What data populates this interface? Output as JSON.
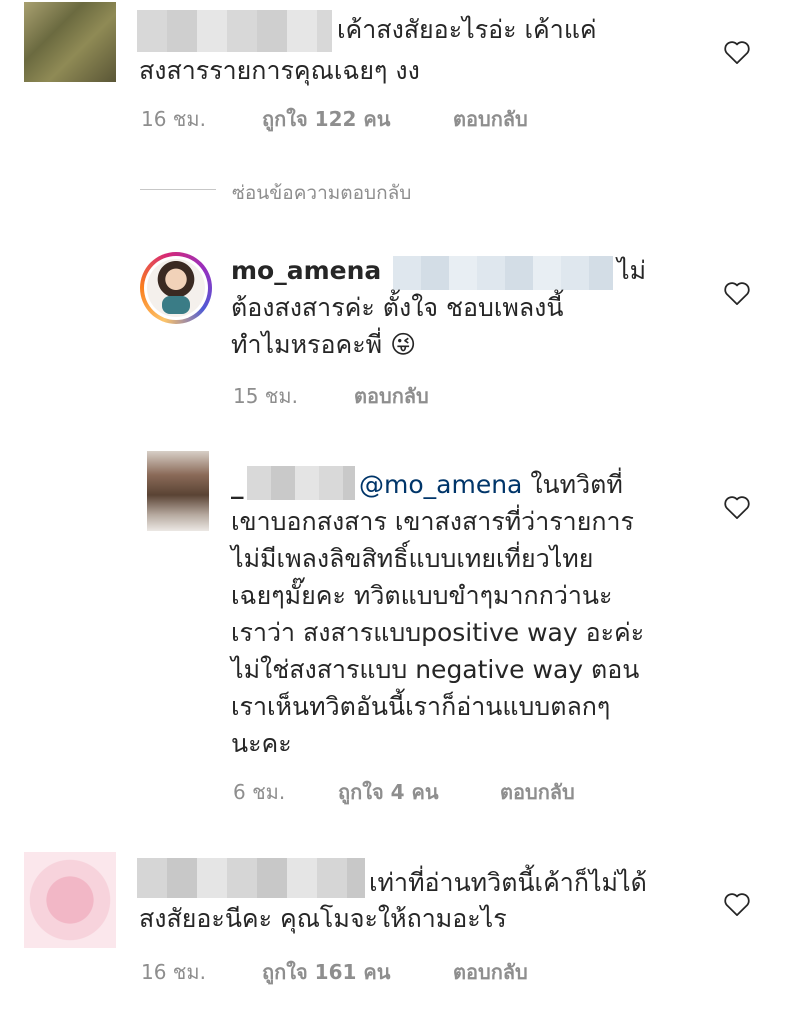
{
  "comments": [
    {
      "text_line1": "เค้าสงสัยอะไรอ่ะ เค้าแค่",
      "text_line2": "สงสารรายการคุณเฉยๆ งง",
      "time": "16 ชม.",
      "likes": "ถูกใจ 122 คน",
      "reply": "ตอบกลับ"
    },
    {
      "text_line1": "เท่าที่อ่านทวิตนี้เค้าก็ไม่ได้",
      "text_line2": "สงสัยอะนีคะ คุณโมจะให้ถามอะไร",
      "time": "16 ชม.",
      "likes": "ถูกใจ 161 คน",
      "reply": "ตอบกลับ"
    }
  ],
  "hide_replies": "ซ่อนข้อความตอบกลับ",
  "replies": [
    {
      "username": "mo_amena",
      "text_tail": "ไม่",
      "text_line2": "ต้องสงสารค่ะ ตั้งใจ ชอบเพลงนี้",
      "text_line3": "ทำไมหรอคะพี่",
      "emoji": "😜",
      "time": "15 ชม.",
      "reply": "ตอบกลับ"
    },
    {
      "username_prefix": "_",
      "mention": "@mo_amena",
      "text_tail": "ในทวิตที่",
      "lines": [
        "เขาบอกสงสาร เขาสงสารที่ว่ารายการ",
        "ไม่มีเพลงลิขสิทธิ์แบบเทยเที่ยวไทย",
        "เฉยๆมั๊ยคะ ทวิตแบบขำๆมากกว่านะ",
        "เราว่า สงสารแบบpositive way อะค่ะ",
        "ไม่ใช่สงสารแบบ negative way ตอน",
        "เราเห็นทวิตอันนี้เราก็อ่านแบบตลกๆ",
        "นะคะ"
      ],
      "time": "6 ชม.",
      "likes": "ถูกใจ 4 คน",
      "reply": "ตอบกลับ"
    }
  ]
}
